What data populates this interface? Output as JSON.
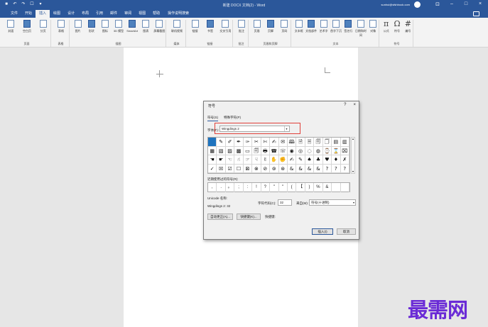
{
  "titlebar": {
    "doc_title": "新建 DOCX 文档(2) - Word",
    "user": "sunhui@sfshbook.com",
    "quick_access": [
      "save-icon",
      "undo-icon",
      "redo-icon",
      "touch-icon",
      "customize-icon"
    ],
    "window_controls": [
      "restore-ribbon-icon",
      "minimize-icon",
      "maximize-icon",
      "close-icon"
    ]
  },
  "tabs": [
    "文件",
    "开始",
    "插入",
    "绘图",
    "设计",
    "布局",
    "引用",
    "邮件",
    "审阅",
    "视图",
    "帮助"
  ],
  "tell_me": "操作说明搜索",
  "ribbon": {
    "groups": [
      {
        "label": "页面",
        "items": [
          "封面",
          "空白页",
          "分页"
        ]
      },
      {
        "label": "表格",
        "items": [
          "表格"
        ]
      },
      {
        "label": "插图",
        "items": [
          "图片",
          "形状",
          "图标",
          "3D 模型",
          "SmartArt",
          "图表",
          "屏幕截图"
        ]
      },
      {
        "label": "媒体",
        "items": [
          "联机视频"
        ]
      },
      {
        "label": "链接",
        "items": [
          "链接",
          "书签",
          "交叉引用"
        ]
      },
      {
        "label": "批注",
        "items": [
          "批注"
        ]
      },
      {
        "label": "页眉和页脚",
        "items": [
          "页眉",
          "页脚",
          "页码"
        ]
      },
      {
        "label": "文本",
        "items": [
          "文本框",
          "文档部件",
          "艺术字",
          "首字下沉",
          "签名行",
          "日期和时间",
          "对象"
        ]
      },
      {
        "label": "符号",
        "items": [
          "公式",
          "符号",
          "编号"
        ]
      }
    ]
  },
  "dialog": {
    "title": "符号",
    "tabs": [
      "符号(S)",
      "特殊字符(P)"
    ],
    "font_label": "字体(F):",
    "font_value": "Wingdings 2",
    "symbols": [
      "",
      "✎",
      "✐",
      "✒",
      "✑",
      "✂",
      "✄",
      "✍",
      "✉",
      "🕮",
      "🗎",
      "🗏",
      "🗐",
      "🗍",
      "▤",
      "▥",
      "▦",
      "▧",
      "▨",
      "▩",
      "▭",
      "🗐",
      "🖶",
      "☎",
      "☏",
      "◉",
      "◎",
      "◌",
      "◍",
      "⌚",
      "⌛",
      "⌧",
      "☚",
      "☛",
      "☜",
      "☝",
      "☞",
      "☟",
      "✌",
      "✋",
      "✊",
      "✍",
      "✎",
      "♠",
      "♣",
      "♥",
      "♦",
      "✗",
      "✓",
      "☒",
      "☑",
      "☐",
      "⊠",
      "⊗",
      "⊘",
      "⊚",
      "⊛",
      "&",
      "&",
      "&",
      "&",
      "?",
      "?",
      "?"
    ],
    "recent_label": "近期使用过的符号(R):",
    "recent": [
      ",",
      ".",
      "。",
      ";",
      ":",
      "!",
      "?",
      "\"",
      "\"",
      "(",
      "【",
      ")",
      "%",
      "&",
      "",
      ""
    ],
    "unicode_name_label": "Unicode 名称:",
    "unicode_name": "Wingdings 2: 32",
    "char_code_label": "字符代码(C):",
    "char_code": "32",
    "from_label": "来自(M):",
    "from_value": "符号(十进制)",
    "autocorrect_button": "自动更正(A)...",
    "shortcut_key_button": "快捷键(K)...",
    "shortcut_label": "快捷键:",
    "insert_button": "插入(I)",
    "cancel_button": "取消"
  },
  "watermark": "最需网"
}
